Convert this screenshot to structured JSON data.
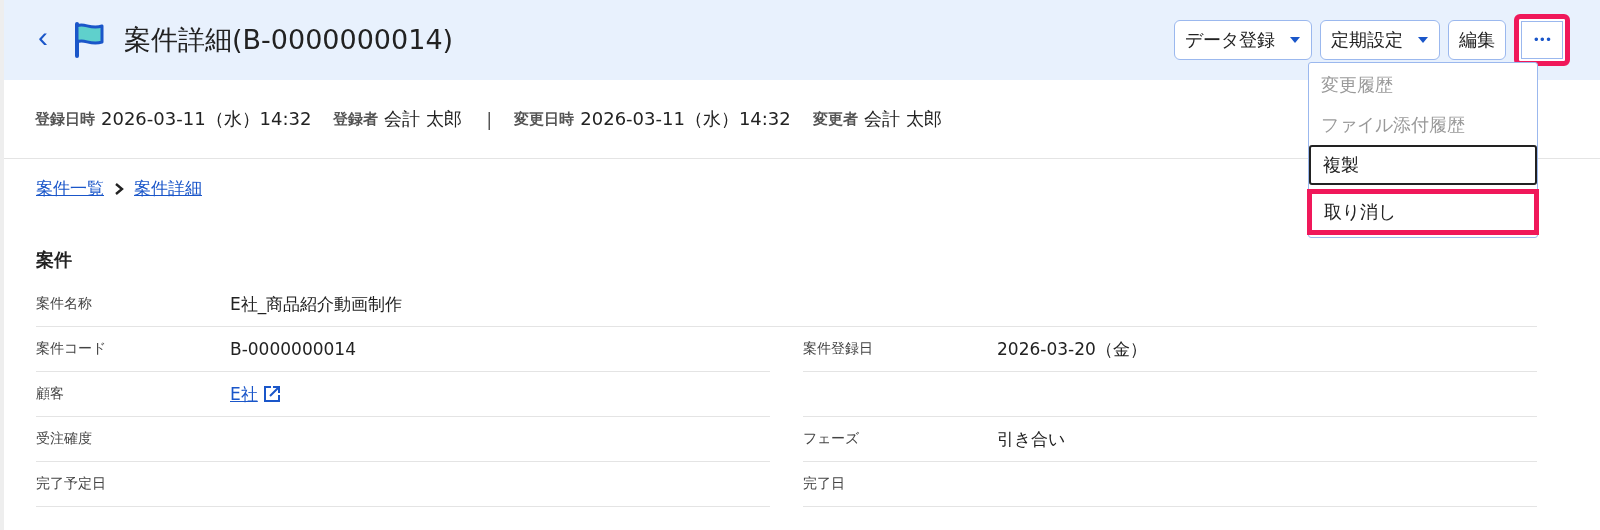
{
  "header": {
    "back": "‹",
    "title": "案件詳細(B-0000000014)",
    "buttons": [
      {
        "label": "データ登録",
        "kind": "dropdown",
        "highlighted": false
      },
      {
        "label": "定期設定",
        "kind": "dropdown",
        "highlighted": false
      },
      {
        "label": "編集",
        "kind": "plain",
        "highlighted": false
      },
      {
        "label": "•••",
        "kind": "more",
        "highlighted": true
      }
    ]
  },
  "menu": [
    {
      "label": "変更履歴",
      "disabled": true,
      "focused": false,
      "highlighted": false
    },
    {
      "label": "ファイル添付履歴",
      "disabled": true,
      "focused": false,
      "highlighted": false
    },
    {
      "label": "複製",
      "disabled": false,
      "focused": true,
      "highlighted": false
    },
    {
      "label": "取り消し",
      "disabled": false,
      "focused": false,
      "highlighted": true
    }
  ],
  "meta": [
    {
      "label": "登録日時",
      "value": "2026-03-11（水）14:32"
    },
    {
      "label": "登録者",
      "value": "会計 太郎"
    },
    {
      "kind": "separator",
      "label": "|"
    },
    {
      "label": "変更日時",
      "value": "2026-03-11（水）14:32"
    },
    {
      "label": "変更者",
      "value": "会計 太郎"
    }
  ],
  "breadcrumb": [
    "案件一覧",
    "案件詳細"
  ],
  "section": {
    "title": "案件",
    "rows": [
      {
        "kind": "wide",
        "cells": [
          {
            "label": "案件名称",
            "value": "E社_商品紹介動画制作",
            "kind": "text"
          }
        ]
      },
      {
        "kind": "pair",
        "cells": [
          {
            "label": "案件コード",
            "value": "B-0000000014",
            "kind": "text"
          },
          {
            "label": "案件登録日",
            "value": "2026-03-20（金）",
            "kind": "text"
          }
        ]
      },
      {
        "kind": "pair",
        "cells": [
          {
            "label": "顧客",
            "value": "E社",
            "kind": "link"
          }
        ]
      },
      {
        "kind": "pair",
        "cells": [
          {
            "label": "受注確度"
          },
          {
            "label": "フェーズ",
            "value": "引き合い",
            "kind": "text"
          }
        ]
      },
      {
        "kind": "pair",
        "cells": [
          {
            "label": "完了予定日"
          },
          {
            "label": "完了日"
          }
        ]
      }
    ]
  }
}
